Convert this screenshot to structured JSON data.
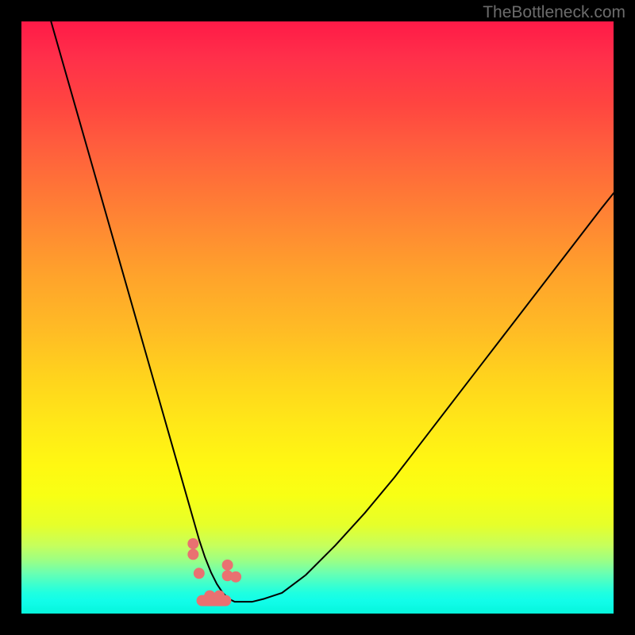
{
  "watermark": "TheBottleneck.com",
  "chart_data": {
    "type": "line",
    "title": "",
    "xlabel": "",
    "ylabel": "",
    "xlim": [
      0,
      100
    ],
    "ylim": [
      0,
      100
    ],
    "grid": false,
    "series": [
      {
        "name": "curve",
        "x": [
          5,
          7,
          9,
          11,
          13,
          15,
          17,
          19,
          21,
          23,
          25,
          27,
          29,
          30,
          31,
          32,
          33,
          34,
          35,
          36,
          37,
          39,
          41,
          44,
          48,
          53,
          58,
          63,
          68,
          73,
          78,
          83,
          88,
          93,
          98,
          100
        ],
        "values": [
          100,
          93,
          86,
          79,
          72,
          65,
          58,
          51,
          44,
          37,
          30,
          23,
          16,
          12.5,
          9.5,
          7,
          5,
          3.5,
          2.5,
          2,
          2,
          2,
          2.5,
          3.5,
          6.5,
          11.5,
          17,
          23,
          29.5,
          36,
          42.5,
          49,
          55.5,
          62,
          68.5,
          71
        ]
      },
      {
        "name": "highlight-dots",
        "x": [
          29.0,
          29.0,
          30.0,
          34.8,
          34.8,
          36.2,
          31.8,
          33.4
        ],
        "values": [
          11.8,
          10.0,
          6.8,
          6.4,
          8.2,
          6.2,
          3.0,
          3.0
        ]
      },
      {
        "name": "highlight-bar",
        "x": [
          30.5,
          31.5,
          32.5,
          33.5,
          34.5
        ],
        "values": [
          2.2,
          2.2,
          2.2,
          2.2,
          2.2
        ]
      }
    ],
    "colors": {
      "curve": "#000000",
      "highlight": "#e97171"
    }
  }
}
